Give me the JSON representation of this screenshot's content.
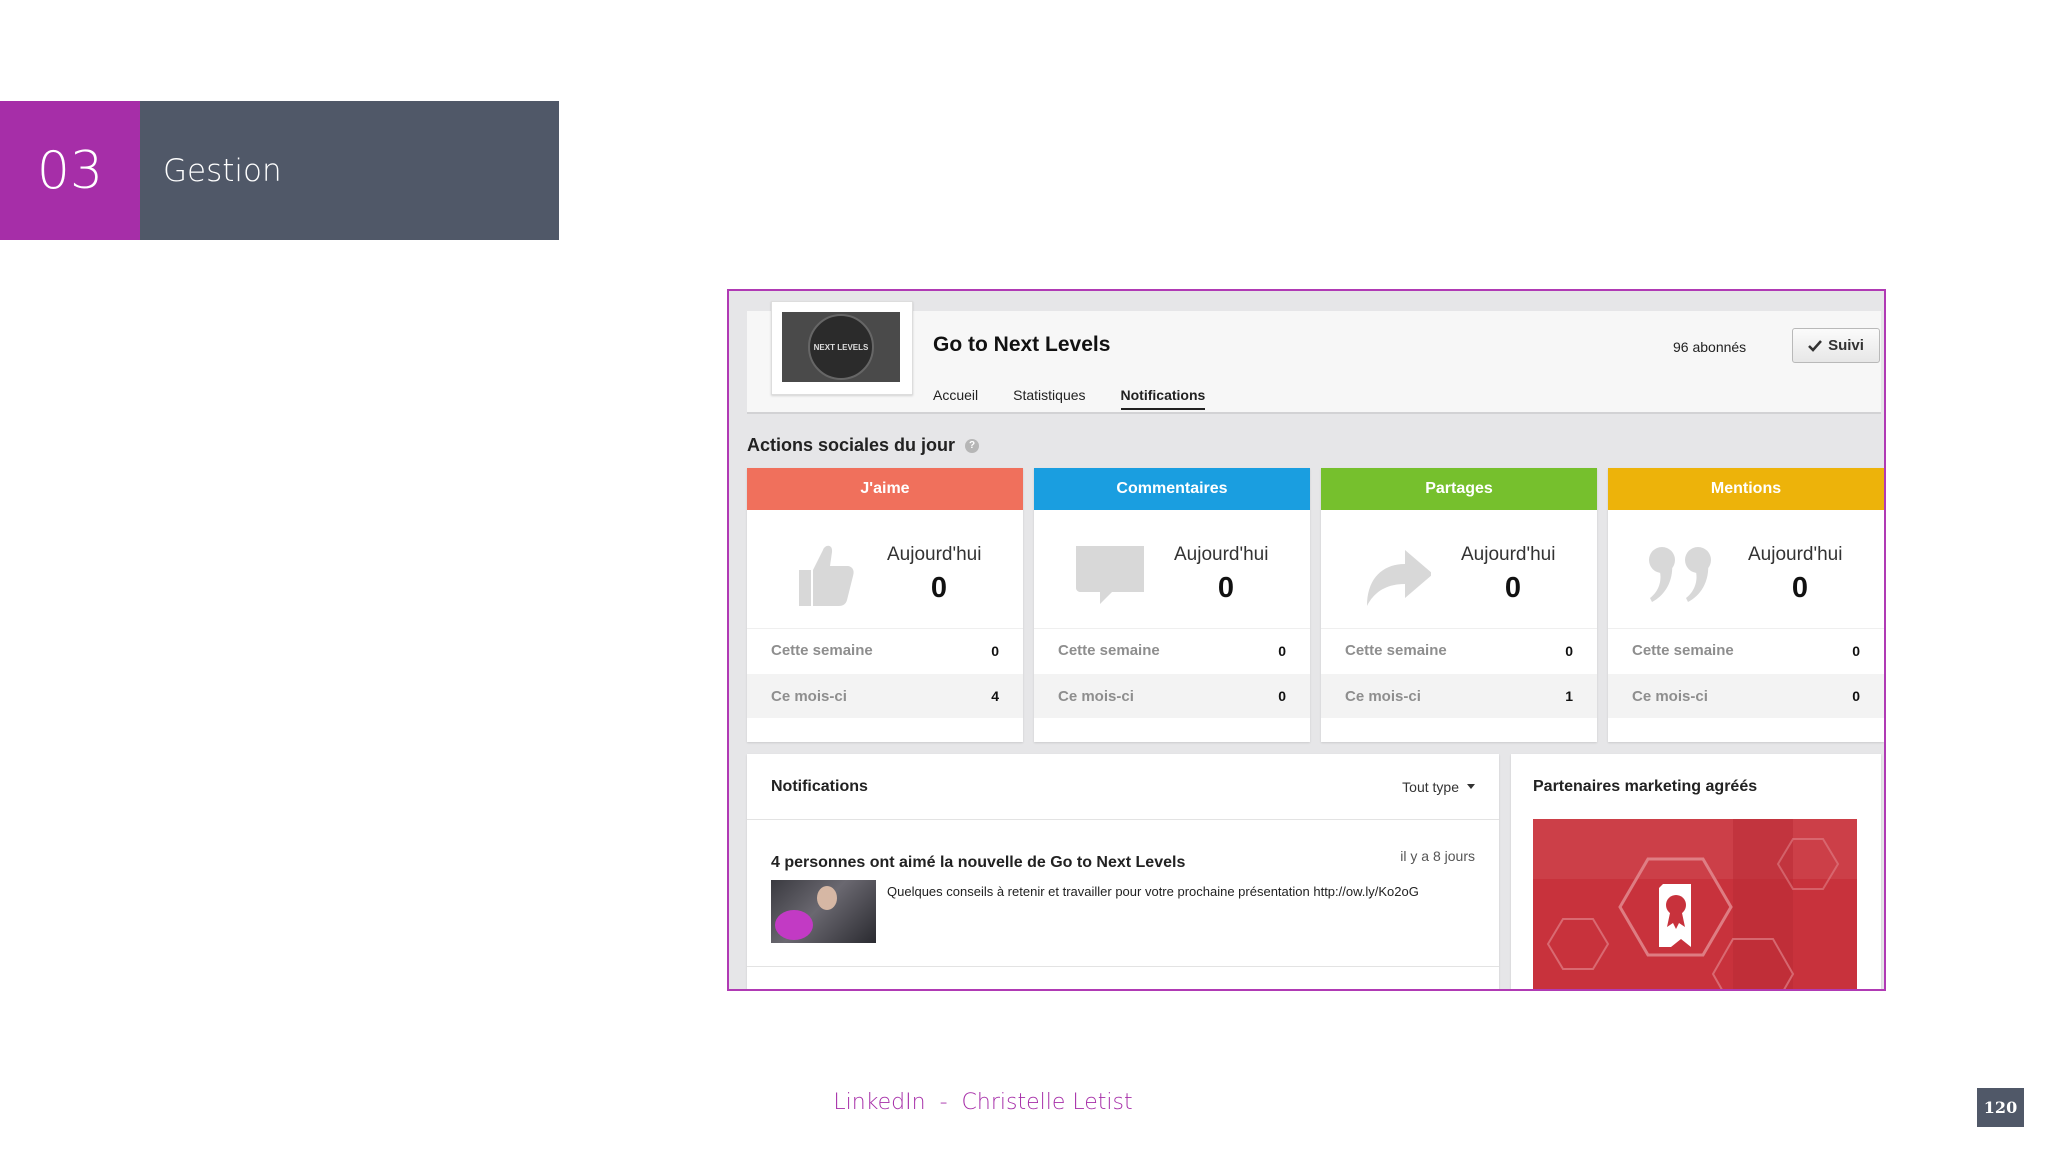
{
  "slide": {
    "section_number": "03",
    "section_title": "Gestion",
    "footer_left": "LinkedIn",
    "footer_sep": "-",
    "footer_right": "Christelle Letist",
    "page_number": "120"
  },
  "company": {
    "name": "Go to Next Levels",
    "followers": "96 abonnés",
    "follow_button": "Suivi",
    "logo_text": "NEXT LEVELS",
    "tabs": [
      "Accueil",
      "Statistiques",
      "Notifications"
    ],
    "active_tab": "Notifications"
  },
  "social": {
    "heading": "Actions sociales du jour",
    "help_glyph": "?",
    "cards": [
      {
        "title": "J'aime",
        "color": "#f0705c",
        "icon": "thumbs-up-icon",
        "today_label": "Aujourd'hui",
        "today": "0",
        "week_label": "Cette semaine",
        "week": "0",
        "month_label": "Ce mois-ci",
        "month": "4"
      },
      {
        "title": "Commentaires",
        "color": "#1a9ee0",
        "icon": "comment-icon",
        "today_label": "Aujourd'hui",
        "today": "0",
        "week_label": "Cette semaine",
        "week": "0",
        "month_label": "Ce mois-ci",
        "month": "0"
      },
      {
        "title": "Partages",
        "color": "#76c02d",
        "icon": "share-icon",
        "today_label": "Aujourd'hui",
        "today": "0",
        "week_label": "Cette semaine",
        "week": "0",
        "month_label": "Ce mois-ci",
        "month": "1"
      },
      {
        "title": "Mentions",
        "color": "#edb30a",
        "icon": "quote-icon",
        "today_label": "Aujourd'hui",
        "today": "0",
        "week_label": "Cette semaine",
        "week": "0",
        "month_label": "Ce mois-ci",
        "month": "0"
      }
    ]
  },
  "notifications": {
    "title": "Notifications",
    "filter": "Tout type",
    "item": {
      "title": "4 personnes ont aimé la nouvelle de Go to Next Levels",
      "time": "il y a 8 jours",
      "text": "Quelques conseils à retenir et travailler pour votre prochaine présentation http://ow.ly/Ko2oG"
    }
  },
  "partners": {
    "title": "Partenaires marketing agréés"
  }
}
